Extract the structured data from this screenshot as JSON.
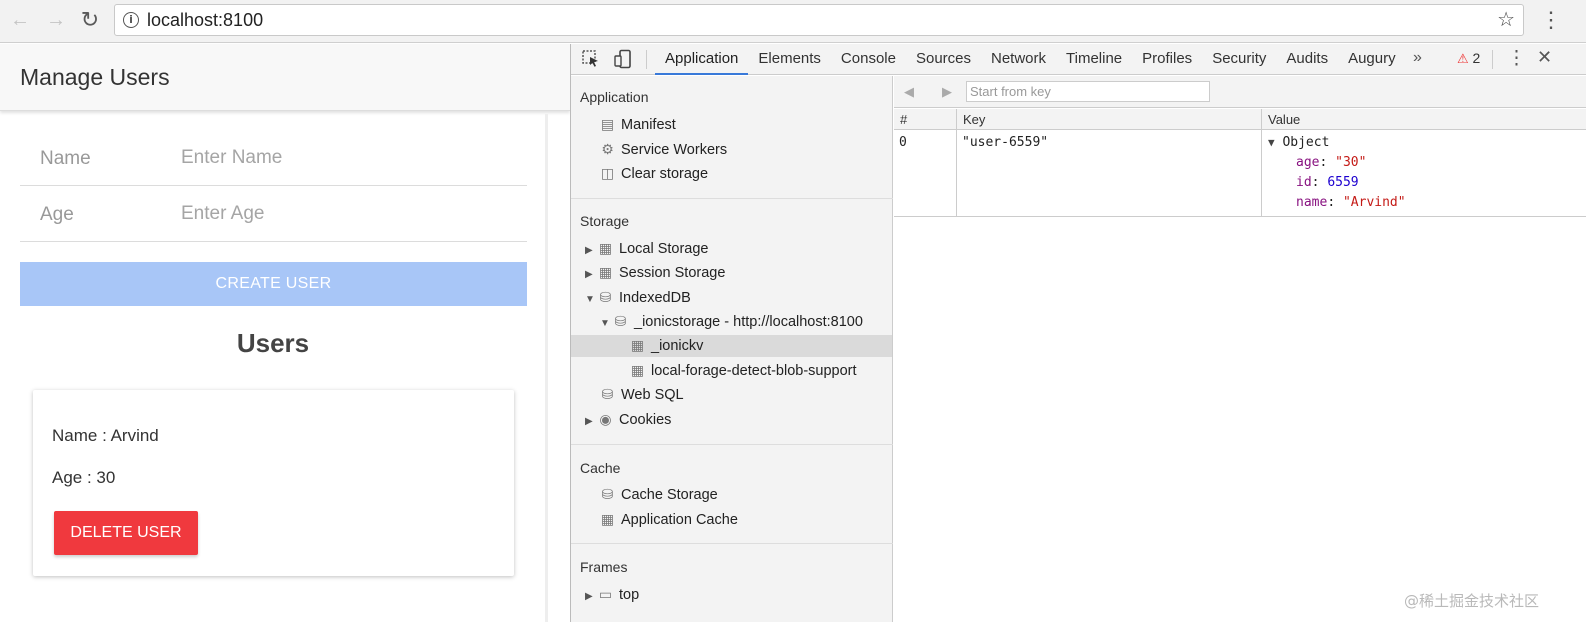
{
  "browser": {
    "url": "localhost:8100"
  },
  "app": {
    "title": "Manage Users",
    "form": {
      "name_label": "Name",
      "name_placeholder": "Enter Name",
      "age_label": "Age",
      "age_placeholder": "Enter Age",
      "create_label": "CREATE USER"
    },
    "users_heading": "Users",
    "user_card": {
      "name_line": "Name : Arvind",
      "age_line": "Age : 30",
      "delete_label": "DELETE USER"
    }
  },
  "devtools": {
    "tabs": [
      "Application",
      "Elements",
      "Console",
      "Sources",
      "Network",
      "Timeline",
      "Profiles",
      "Security",
      "Audits",
      "Augury"
    ],
    "active_tab": "Application",
    "more_tabs": "»",
    "warning_count": "2",
    "sidebar": {
      "application": {
        "title": "Application",
        "items": [
          "Manifest",
          "Service Workers",
          "Clear storage"
        ]
      },
      "storage": {
        "title": "Storage",
        "local_storage": "Local Storage",
        "session_storage": "Session Storage",
        "indexeddb": "IndexedDB",
        "db_name": "_ionicstorage - http://localhost:8100",
        "store_ionickv": "_ionickv",
        "store_blob": "local-forage-detect-blob-support",
        "web_sql": "Web SQL",
        "cookies": "Cookies"
      },
      "cache": {
        "title": "Cache",
        "items": [
          "Cache Storage",
          "Application Cache"
        ]
      },
      "frames": {
        "title": "Frames",
        "top": "top"
      }
    },
    "db_view": {
      "key_placeholder": "Start from key",
      "columns": [
        "#",
        "Key",
        "Value"
      ],
      "row": {
        "index": "0",
        "key": "\"user-6559\"",
        "value_header": "Object",
        "props": [
          {
            "key": "age",
            "value": "\"30\""
          },
          {
            "key": "id",
            "value": "6559"
          },
          {
            "key": "name",
            "value": "\"Arvind\""
          }
        ]
      }
    }
  },
  "watermark": "@稀土掘金技术社区"
}
